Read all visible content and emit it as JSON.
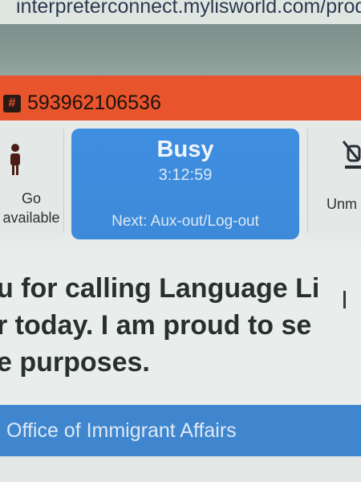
{
  "browser": {
    "url": "interpreterconnect.mylisworld.com/prod/"
  },
  "header": {
    "call_id": "593962106536"
  },
  "status_bar": {
    "go_available": {
      "label_line1": "Go",
      "label_line2": "available"
    },
    "current_status": {
      "title": "Busy",
      "timer": "3:12:59",
      "next_label": "Next: Aux-out/Log-out"
    },
    "unmute": {
      "label": "Unm"
    }
  },
  "script": {
    "line1": "u for calling Language Li",
    "line2": "r today. I am proud to se",
    "line3": "e purposes."
  },
  "footer": {
    "office_name": "Office of Immigrant Affairs"
  },
  "colors": {
    "id_bar": "#e8542c",
    "status_card": "#3f8ee0",
    "office_bar": "#3f86cf"
  }
}
